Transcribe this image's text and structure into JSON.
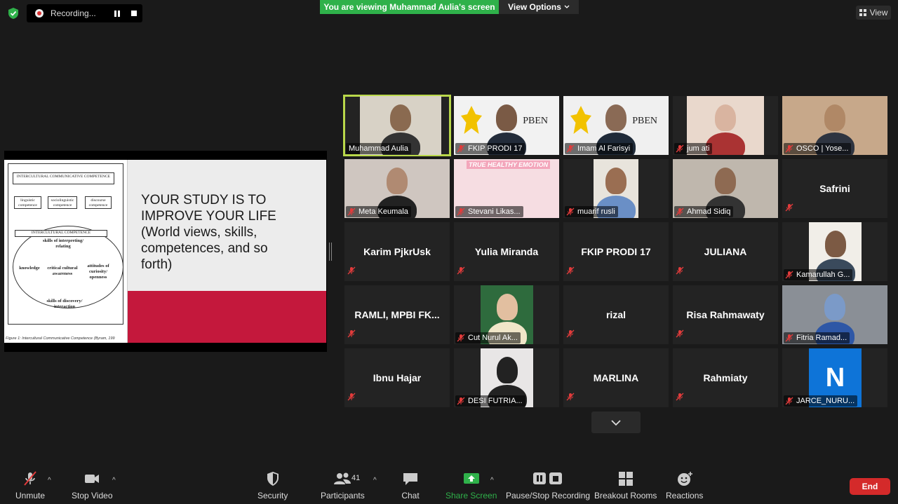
{
  "recording": {
    "label": "Recording..."
  },
  "banner": {
    "viewing": "You are viewing Muhammad Aulia's screen",
    "view_options": "View Options",
    "view": "View"
  },
  "slide": {
    "heading_line1": "YOUR STUDY IS TO",
    "heading_line2": "IMPROVE YOUR LIFE",
    "heading_line3": "(World views, skills,",
    "heading_line4": "competences, and so",
    "heading_line5": "forth)",
    "fig_title": "INTERCULTURAL COMMUNICATIVE COMPETENCE",
    "fig_linguistic": "linguistic competence",
    "fig_sociolinguistic": "sociolinguistic competence",
    "fig_discourse": "discourse competence",
    "fig_ic": "INTERCULTURAL COMPETENCE",
    "fig_interpreting": "skills of interpreting/ relating",
    "fig_knowledge": "knowledge",
    "fig_critical": "critical cultural awareness",
    "fig_attitudes": "attitudes of curiosity/ openness",
    "fig_discovery": "skills of discovery/ interaction",
    "fig_caption": "Figure 1: Intercultural Communicative Competence (Byram, 199"
  },
  "participants": [
    {
      "label": "Muhammad Aulia",
      "video": true,
      "active": true
    },
    {
      "label": "FKIP PRODI 17",
      "video": true
    },
    {
      "label": "Imam Al Farisyi",
      "video": true
    },
    {
      "label": "jum ati",
      "video": true
    },
    {
      "label": "OSCO | Yose...",
      "video": true
    },
    {
      "label": "Meta Keumala",
      "video": true
    },
    {
      "label": "Stevani Likas...",
      "video": true
    },
    {
      "label": "muarif rusli",
      "video": true
    },
    {
      "label": "Ahmad Sidiq",
      "video": true
    },
    {
      "name": "Safrini"
    },
    {
      "name": "Karim PjkrUsk"
    },
    {
      "name": "Yulia Miranda"
    },
    {
      "name": "FKIP PRODI 17"
    },
    {
      "name": "JULIANA"
    },
    {
      "label": "Kamarullah G...",
      "video": true
    },
    {
      "name": "RAMLI, MPBI FK..."
    },
    {
      "label": "Cut Nurul Ak...",
      "video": true
    },
    {
      "name": "rizal"
    },
    {
      "name": "Risa Rahmawaty"
    },
    {
      "label": "Fitria Ramad...",
      "video": true
    },
    {
      "name": "Ibnu Hajar"
    },
    {
      "label": "DESI FUTRIA...",
      "video": true
    },
    {
      "name": "MARLINA"
    },
    {
      "name": "Rahmiaty"
    },
    {
      "label": "JARCE_NURU...",
      "video": true,
      "avatar_letter": "N"
    }
  ],
  "tile_texts": {
    "ppben": "PBEN",
    "healthy": "TRUE HEALTHY EMOTION"
  },
  "toolbar": {
    "unmute": "Unmute",
    "stop_video": "Stop Video",
    "security": "Security",
    "participants": "Participants",
    "participants_count": "41",
    "chat": "Chat",
    "share_screen": "Share Screen",
    "pause_recording": "Pause/Stop Recording",
    "breakout": "Breakout Rooms",
    "reactions": "Reactions",
    "end": "End"
  },
  "colors": {
    "share_green": "#2fb14a",
    "end_red": "#d42a2a",
    "active_speaker": "#b9d84a",
    "muted_red": "#e23b3b"
  }
}
